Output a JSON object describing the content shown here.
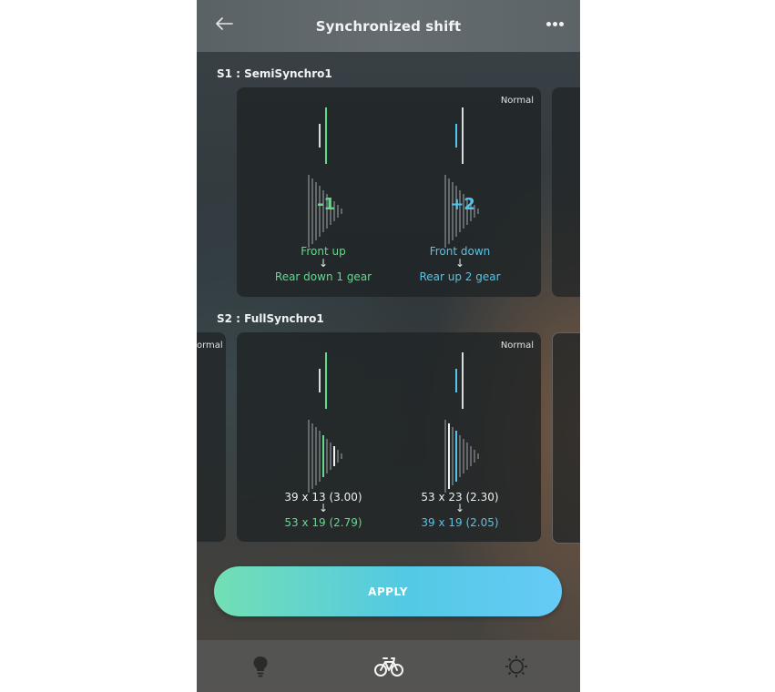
{
  "header": {
    "title": "Synchronized shift"
  },
  "sections": [
    {
      "label": "S1 : SemiSynchro1",
      "mode": "Normal",
      "left": {
        "big": "-1",
        "line1": "Front up",
        "arrow": "↓",
        "line2": "Rear down 1 gear"
      },
      "right": {
        "big": "+2",
        "line1": "Front down",
        "arrow": "↓",
        "line2": "Rear up 2 gear"
      }
    },
    {
      "label": "S2 : FullSynchro1",
      "mode": "Normal",
      "prev_mode": "ormal",
      "left": {
        "line1": "39 x 13 (3.00)",
        "arrow": "↓",
        "line2": "53 x 19 (2.79)"
      },
      "right": {
        "line1": "53 x 23 (2.30)",
        "arrow": "↓",
        "line2": "39 x 19 (2.05)"
      }
    }
  ],
  "apply_label": "APPLY",
  "tabs": [
    "lightbulb-icon",
    "bike-icon",
    "gear-icon"
  ],
  "colors": {
    "green": "#5fdc8a",
    "blue": "#53c4ea",
    "white": "#e6e9ea",
    "apply_start": "#72dfb4",
    "apply_end": "#66cbf6"
  }
}
